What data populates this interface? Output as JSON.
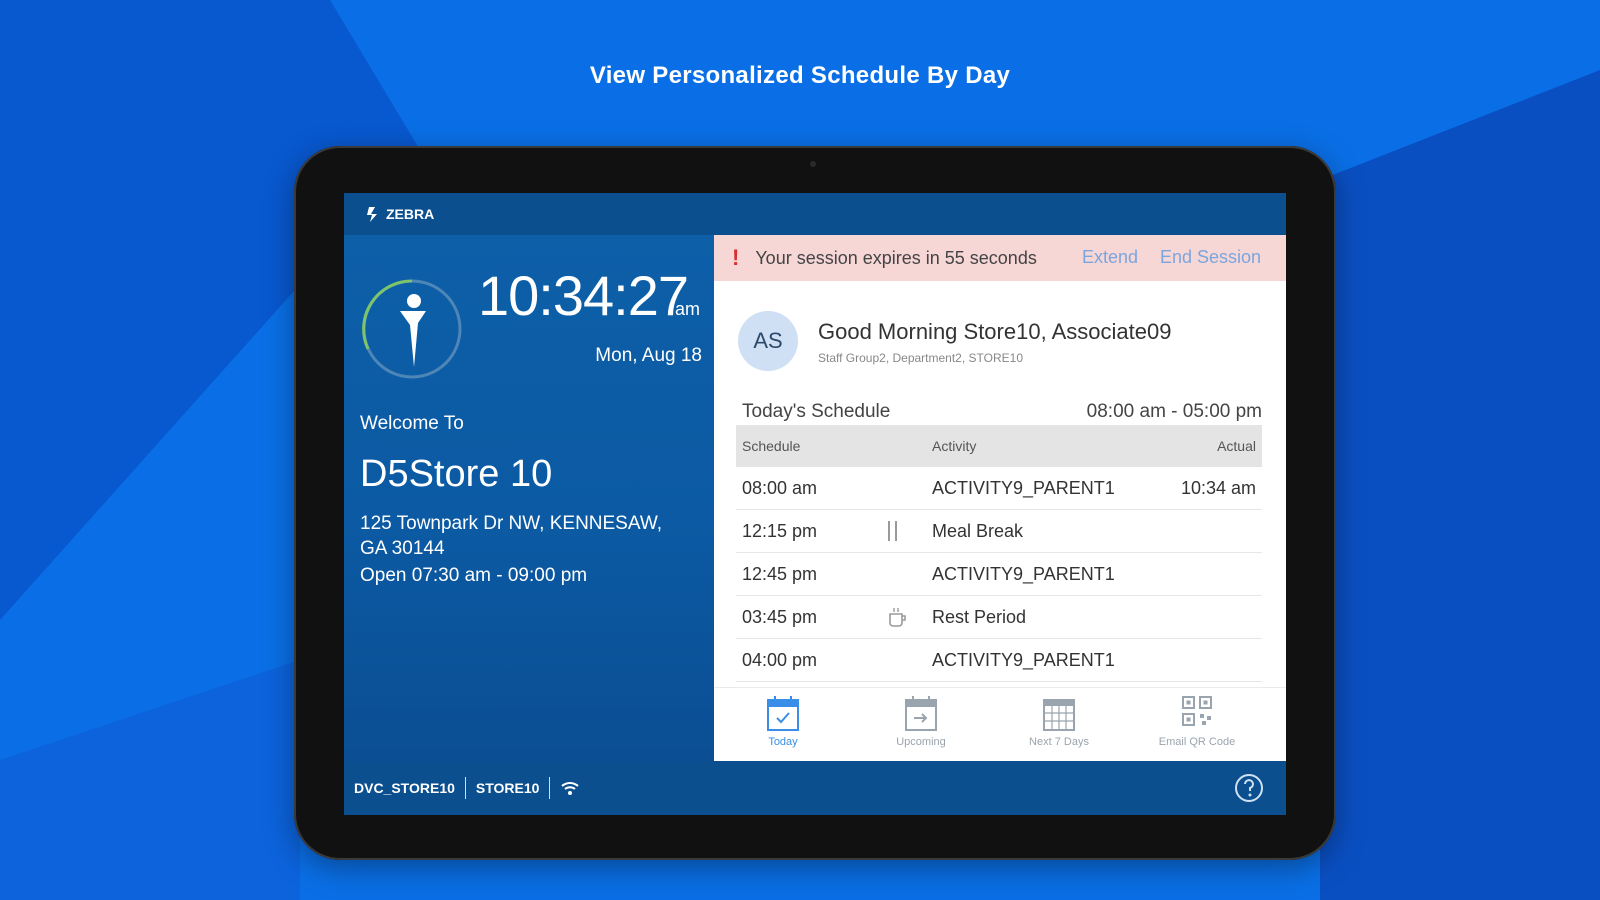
{
  "headline": "View Personalized Schedule By Day",
  "brand": {
    "name": "ZEBRA",
    "icon": "zebra-logo-icon"
  },
  "clock": {
    "time": "10:34:27",
    "ampm": "am",
    "date": "Mon, Aug 18"
  },
  "store": {
    "welcome": "Welcome To",
    "name": "D5Store 10",
    "address": "125 Townpark Dr NW, KENNESAW, GA 30144",
    "hours": "Open 07:30 am - 09:00 pm"
  },
  "session": {
    "message": "Your session expires in 55 seconds",
    "extend": "Extend",
    "end": "End Session"
  },
  "user": {
    "initials": "AS",
    "greeting": "Good Morning Store10, Associate09",
    "group": "Staff Group2, Department2, STORE10"
  },
  "schedule": {
    "title": "Today's Schedule",
    "range": "08:00 am - 05:00 pm",
    "headers": {
      "schedule": "Schedule",
      "activity": "Activity",
      "actual": "Actual"
    },
    "rows": [
      {
        "time": "08:00 am",
        "icon": "",
        "activity": "ACTIVITY9_PARENT1",
        "actual": "10:34 am"
      },
      {
        "time": "12:15 pm",
        "icon": "utensils-icon",
        "activity": "Meal Break",
        "actual": ""
      },
      {
        "time": "12:45 pm",
        "icon": "",
        "activity": "ACTIVITY9_PARENT1",
        "actual": ""
      },
      {
        "time": "03:45 pm",
        "icon": "coffee-cup-icon",
        "activity": "Rest Period",
        "actual": ""
      },
      {
        "time": "04:00 pm",
        "icon": "",
        "activity": "ACTIVITY9_PARENT1",
        "actual": ""
      }
    ]
  },
  "nav": [
    {
      "label": "Today",
      "icon": "calendar-check-icon",
      "active": true
    },
    {
      "label": "Upcoming",
      "icon": "calendar-arrow-icon",
      "active": false
    },
    {
      "label": "Next 7 Days",
      "icon": "calendar-grid-icon",
      "active": false
    },
    {
      "label": "Email QR Code",
      "icon": "qr-code-icon",
      "active": false
    }
  ],
  "footer": {
    "device": "DVC_STORE10",
    "store": "STORE10",
    "wifi_icon": "wifi-icon",
    "help_icon": "help-icon"
  },
  "colors": {
    "accent": "#3a8ee8",
    "session_bg": "#f7d6d6",
    "panel_blue": "#0b5aa3"
  }
}
